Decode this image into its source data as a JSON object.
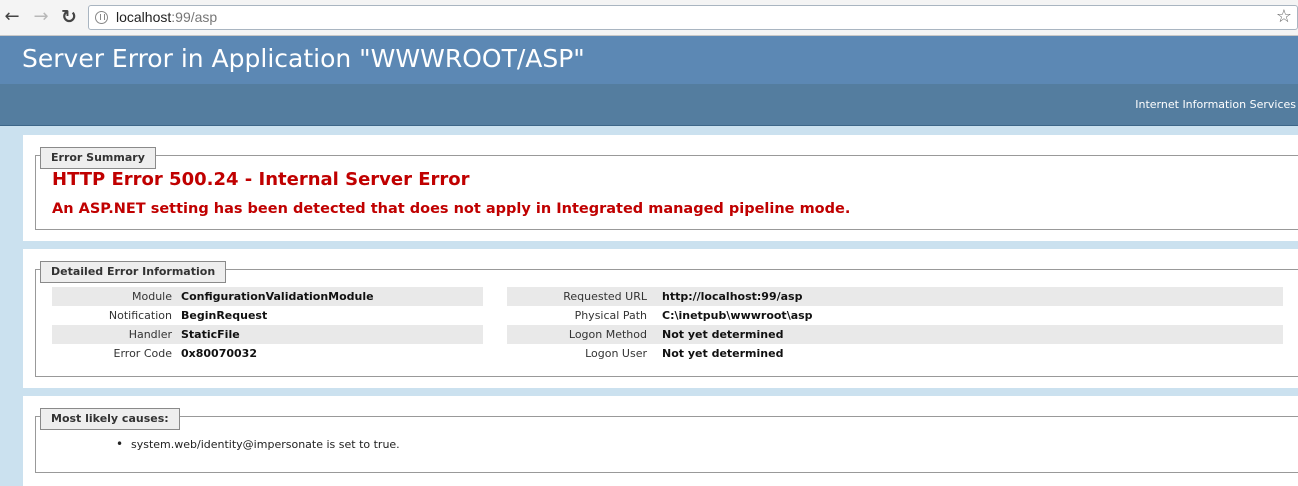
{
  "browser": {
    "url_host": "localhost",
    "url_rest": ":99/asp"
  },
  "header": {
    "title": "Server Error in Application \"WWWROOT/ASP\"",
    "product": "Internet Information Services"
  },
  "error_summary": {
    "legend": "Error Summary",
    "title": "HTTP Error 500.24 - Internal Server Error",
    "message": "An ASP.NET setting has been detected that does not apply in Integrated managed pipeline mode."
  },
  "detailed": {
    "legend": "Detailed Error Information",
    "left": [
      {
        "label": "Module",
        "value": "ConfigurationValidationModule"
      },
      {
        "label": "Notification",
        "value": "BeginRequest"
      },
      {
        "label": "Handler",
        "value": "StaticFile"
      },
      {
        "label": "Error Code",
        "value": "0x80070032"
      }
    ],
    "right": [
      {
        "label": "Requested URL",
        "value": "http://localhost:99/asp"
      },
      {
        "label": "Physical Path",
        "value": "C:\\inetpub\\wwwroot\\asp"
      },
      {
        "label": "Logon Method",
        "value": "Not yet determined"
      },
      {
        "label": "Logon User",
        "value": "Not yet determined"
      }
    ]
  },
  "causes": {
    "legend": "Most likely causes:",
    "items": [
      "system.web/identity@impersonate is set to true."
    ]
  },
  "colors": {
    "header_bg": "#5c88b4",
    "error_red": "#c00000"
  }
}
